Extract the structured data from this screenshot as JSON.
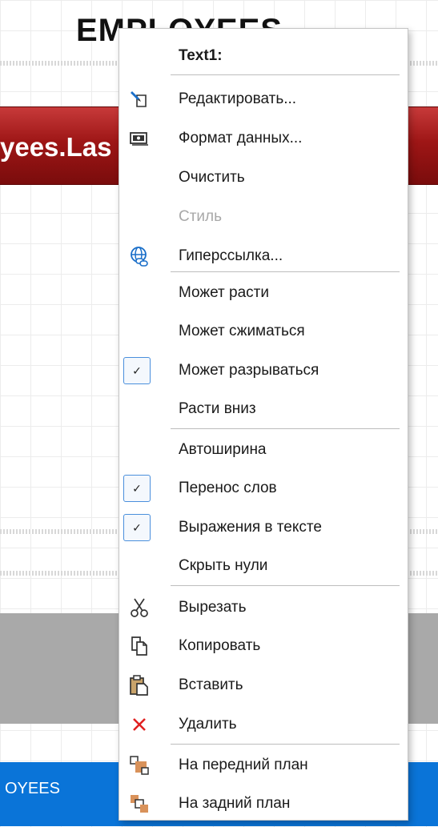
{
  "designer": {
    "report_title": "EMPLOYEES",
    "data_band_text": "yees.Las",
    "page_footer_text": "OYEES"
  },
  "menu": {
    "header": "Text1:",
    "items": [
      {
        "label": "Редактировать...",
        "icon": "edit-icon",
        "enabled": true
      },
      {
        "label": "Формат данных...",
        "icon": "format-icon",
        "enabled": true
      },
      {
        "label": "Очистить",
        "icon": "",
        "enabled": true
      },
      {
        "label": "Стиль",
        "icon": "",
        "enabled": false
      },
      {
        "label": "Гиперссылка...",
        "icon": "hyperlink-icon",
        "enabled": true
      },
      {
        "label": "Может расти",
        "checked": false
      },
      {
        "label": "Может сжиматься",
        "checked": false
      },
      {
        "label": "Может разрываться",
        "checked": true
      },
      {
        "label": "Расти вниз",
        "checked": false
      },
      {
        "label": "Автоширина",
        "checked": false
      },
      {
        "label": "Перенос слов",
        "checked": true
      },
      {
        "label": "Выражения в тексте",
        "checked": true
      },
      {
        "label": "Скрыть нули",
        "checked": false
      },
      {
        "label": "Вырезать",
        "icon": "cut-icon"
      },
      {
        "label": "Копировать",
        "icon": "copy-icon"
      },
      {
        "label": "Вставить",
        "icon": "paste-icon"
      },
      {
        "label": "Удалить",
        "icon": "delete-icon"
      },
      {
        "label": "На передний план",
        "icon": "bring-to-front-icon"
      },
      {
        "label": "На задний план",
        "icon": "send-to-back-icon"
      }
    ]
  },
  "colors": {
    "accent": "#0a74d8",
    "band_red": "#9e1616",
    "delete_red": "#e02020",
    "layer_orange": "#d9925a",
    "icon_blue": "#1a6fc9"
  }
}
